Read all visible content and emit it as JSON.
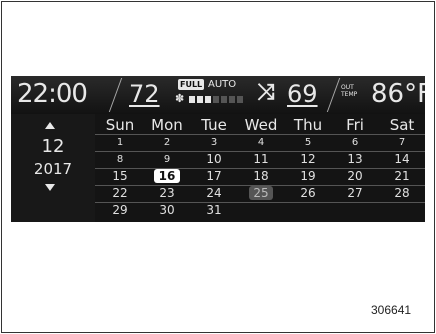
{
  "status_bar": {
    "clock": "22:00",
    "driver_temp": "72",
    "full_label": "FULL",
    "auto_label": "AUTO",
    "fan_level_of_7": 3,
    "passenger_temp": "69",
    "outside_label_line1": "OUT",
    "outside_label_line2": "TEMP",
    "outside_temp": "86°F"
  },
  "calendar": {
    "month": "12",
    "year": "2017",
    "weekdays": [
      "Sun",
      "Mon",
      "Tue",
      "Wed",
      "Thu",
      "Fri",
      "Sat"
    ],
    "weeks": [
      [
        "1",
        "2",
        "3",
        "4",
        "5",
        "6",
        "7"
      ],
      [
        "8",
        "9",
        "10",
        "11",
        "12",
        "13",
        "14"
      ],
      [
        "15",
        "16",
        "17",
        "18",
        "19",
        "20",
        "21"
      ],
      [
        "22",
        "23",
        "24",
        "25",
        "26",
        "27",
        "28"
      ],
      [
        "29",
        "30",
        "31",
        "",
        "",
        "",
        ""
      ]
    ],
    "selected_day": "16",
    "today_day": "25"
  },
  "figure_number": "306641",
  "colors": {
    "screen_bg": "#0f0f0f",
    "text": "#e8e8e8",
    "fan_on": "#e8e8e8",
    "fan_off": "#555555"
  }
}
